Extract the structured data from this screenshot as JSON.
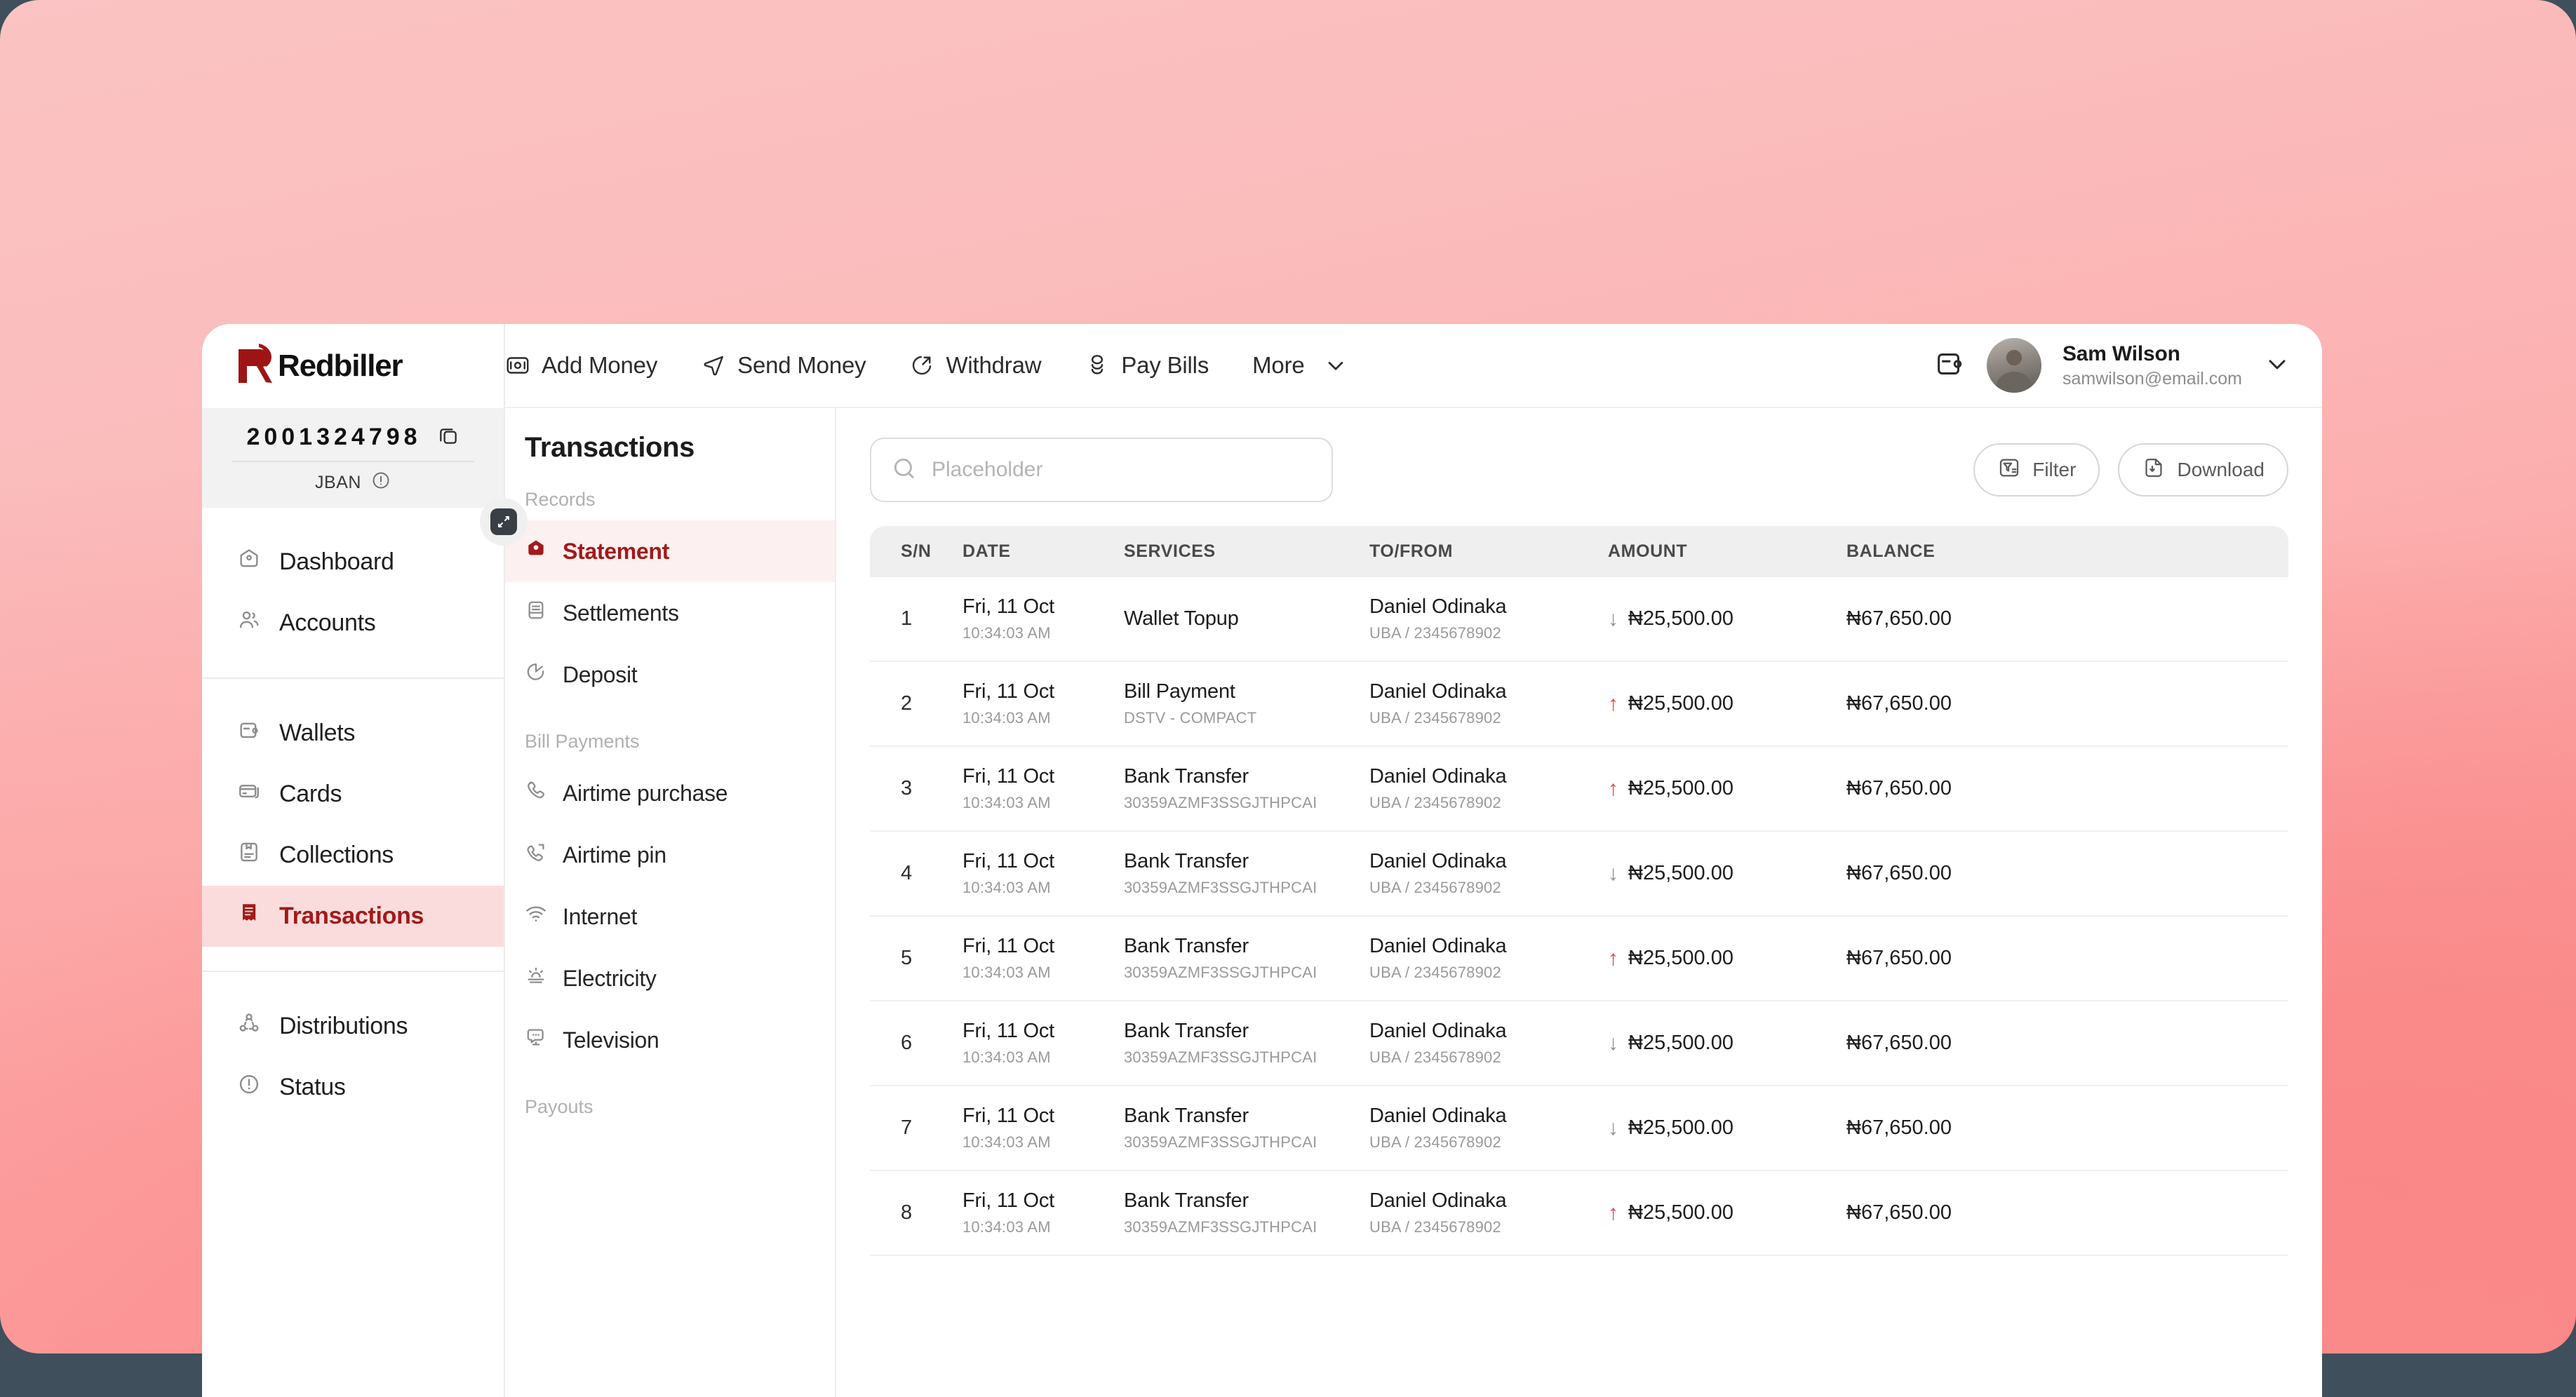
{
  "brand": {
    "name": "Redbiller",
    "logo_icon": "redbiller-logo-icon",
    "accent_red": "#a21a1a",
    "accent_red_light": "#fadcdc",
    "debit_red": "#f43c3c"
  },
  "topbar": {
    "quick_actions": [
      {
        "label": "Add Money",
        "icon": "add-money-icon"
      },
      {
        "label": "Send Money",
        "icon": "send-money-icon"
      },
      {
        "label": "Withdraw",
        "icon": "withdraw-icon"
      },
      {
        "label": "Pay Bills",
        "icon": "pay-bills-icon"
      }
    ],
    "more_label": "More",
    "more_icon": "chevron-down-icon",
    "wallet_icon": "wallet-icon",
    "user": {
      "name": "Sam Wilson",
      "email": "samwilson@email.com",
      "avatar_icon": "avatar",
      "caret_icon": "chevron-down-icon"
    }
  },
  "sidebar": {
    "collapse_icon": "collapse-icon",
    "account": {
      "number": "2001324798",
      "copy_icon": "copy-icon",
      "type_label": "JBAN",
      "info_icon": "info-icon"
    },
    "groups": [
      {
        "items": [
          {
            "label": "Dashboard",
            "icon": "dashboard-icon",
            "active": false
          },
          {
            "label": "Accounts",
            "icon": "accounts-icon",
            "active": false
          }
        ]
      },
      {
        "items": [
          {
            "label": "Wallets",
            "icon": "wallet-icon",
            "active": false
          },
          {
            "label": "Cards",
            "icon": "card-icon",
            "active": false
          },
          {
            "label": "Collections",
            "icon": "collections-icon",
            "active": false
          },
          {
            "label": "Transactions",
            "icon": "transactions-icon",
            "active": true
          }
        ]
      },
      {
        "items": [
          {
            "label": "Distributions",
            "icon": "distributions-icon",
            "active": false
          },
          {
            "label": "Status",
            "icon": "status-icon",
            "active": false
          }
        ]
      }
    ]
  },
  "subnav": {
    "title": "Transactions",
    "sections": [
      {
        "label": "Records",
        "items": [
          {
            "label": "Statement",
            "icon": "statement-icon",
            "active": true
          },
          {
            "label": "Settlements",
            "icon": "settlements-icon",
            "active": false
          },
          {
            "label": "Deposit",
            "icon": "deposit-icon",
            "active": false
          }
        ]
      },
      {
        "label": "Bill Payments",
        "items": [
          {
            "label": "Airtime purchase",
            "icon": "phone-icon",
            "active": false
          },
          {
            "label": "Airtime pin",
            "icon": "phone-pin-icon",
            "active": false
          },
          {
            "label": "Internet",
            "icon": "wifi-icon",
            "active": false
          },
          {
            "label": "Electricity",
            "icon": "electricity-icon",
            "active": false
          },
          {
            "label": "Television",
            "icon": "television-icon",
            "active": false
          }
        ]
      },
      {
        "label": "Payouts",
        "items": []
      }
    ]
  },
  "main": {
    "search": {
      "placeholder": "Placeholder",
      "value": "",
      "icon": "search-icon"
    },
    "filter_button": {
      "label": "Filter",
      "icon": "filter-icon"
    },
    "download_button": {
      "label": "Download",
      "icon": "download-icon"
    },
    "table": {
      "columns": [
        "S/N",
        "DATE",
        "SERVICES",
        "TO/FROM",
        "AMOUNT",
        "BALANCE"
      ],
      "rows": [
        {
          "sn": "1",
          "date": "Fri, 11 Oct",
          "time": "10:34:03 AM",
          "service": "Wallet Topup",
          "reference": "",
          "name": "Daniel Odinaka",
          "account": "UBA / 2345678902",
          "direction": "credit",
          "arrow": "↓",
          "amount": "₦25,500.00",
          "balance": "₦67,650.00"
        },
        {
          "sn": "2",
          "date": "Fri, 11 Oct",
          "time": "10:34:03 AM",
          "service": "Bill Payment",
          "reference": "DSTV - COMPACT",
          "name": "Daniel Odinaka",
          "account": "UBA / 2345678902",
          "direction": "debit",
          "arrow": "↑",
          "amount": "₦25,500.00",
          "balance": "₦67,650.00"
        },
        {
          "sn": "3",
          "date": "Fri, 11 Oct",
          "time": "10:34:03 AM",
          "service": "Bank Transfer",
          "reference": "30359AZMF3SSGJTHPCAI",
          "name": "Daniel Odinaka",
          "account": "UBA / 2345678902",
          "direction": "debit",
          "arrow": "↑",
          "amount": "₦25,500.00",
          "balance": "₦67,650.00"
        },
        {
          "sn": "4",
          "date": "Fri, 11 Oct",
          "time": "10:34:03 AM",
          "service": "Bank Transfer",
          "reference": "30359AZMF3SSGJTHPCAI",
          "name": "Daniel Odinaka",
          "account": "UBA / 2345678902",
          "direction": "credit",
          "arrow": "↓",
          "amount": "₦25,500.00",
          "balance": "₦67,650.00"
        },
        {
          "sn": "5",
          "date": "Fri, 11 Oct",
          "time": "10:34:03 AM",
          "service": "Bank Transfer",
          "reference": "30359AZMF3SSGJTHPCAI",
          "name": "Daniel Odinaka",
          "account": "UBA / 2345678902",
          "direction": "debit",
          "arrow": "↑",
          "amount": "₦25,500.00",
          "balance": "₦67,650.00"
        },
        {
          "sn": "6",
          "date": "Fri, 11 Oct",
          "time": "10:34:03 AM",
          "service": "Bank Transfer",
          "reference": "30359AZMF3SSGJTHPCAI",
          "name": "Daniel Odinaka",
          "account": "UBA / 2345678902",
          "direction": "credit",
          "arrow": "↓",
          "amount": "₦25,500.00",
          "balance": "₦67,650.00"
        },
        {
          "sn": "7",
          "date": "Fri, 11 Oct",
          "time": "10:34:03 AM",
          "service": "Bank Transfer",
          "reference": "30359AZMF3SSGJTHPCAI",
          "name": "Daniel Odinaka",
          "account": "UBA / 2345678902",
          "direction": "credit",
          "arrow": "↓",
          "amount": "₦25,500.00",
          "balance": "₦67,650.00"
        },
        {
          "sn": "8",
          "date": "Fri, 11 Oct",
          "time": "10:34:03 AM",
          "service": "Bank Transfer",
          "reference": "30359AZMF3SSGJTHPCAI",
          "name": "Daniel Odinaka",
          "account": "UBA / 2345678902",
          "direction": "debit",
          "arrow": "↑",
          "amount": "₦25,500.00",
          "balance": "₦67,650.00"
        }
      ]
    }
  }
}
